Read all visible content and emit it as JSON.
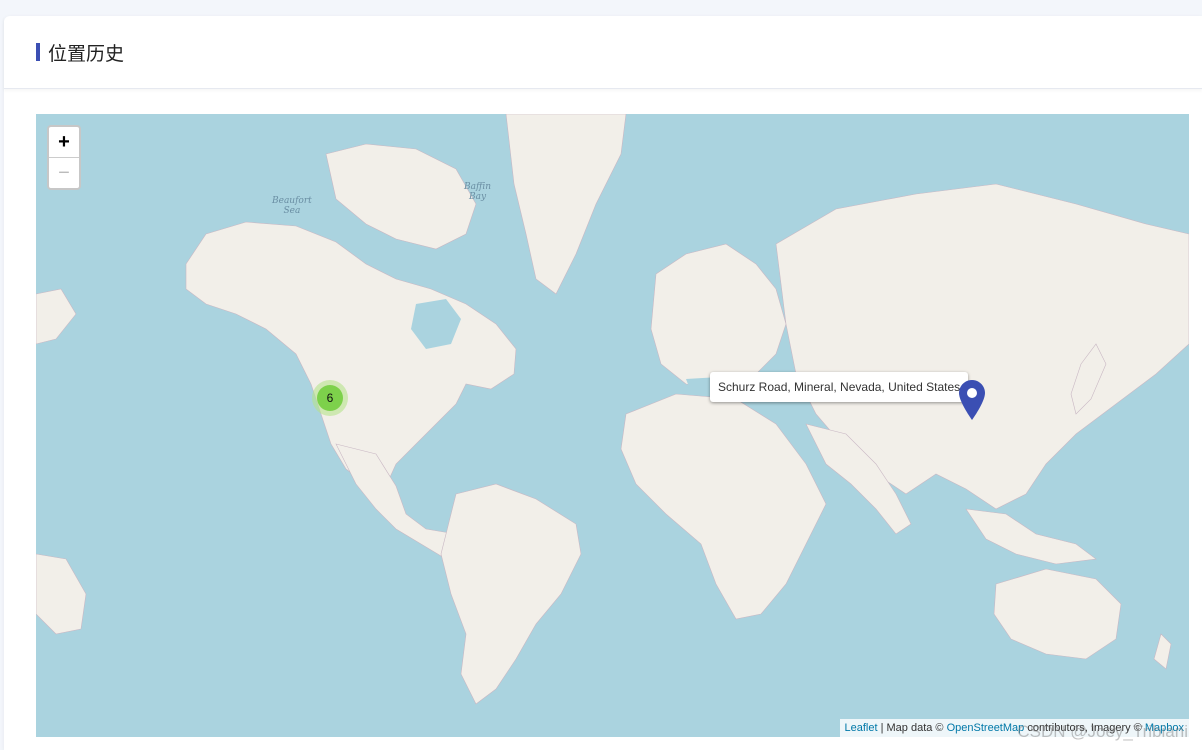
{
  "page": {
    "title": "位置历史"
  },
  "map": {
    "zoom_in": "+",
    "zoom_out": "−",
    "sea_labels": {
      "beaufort": [
        "Beaufort",
        "Sea"
      ],
      "baffin": [
        "Baffin",
        "Bay"
      ]
    },
    "cluster_count": "6",
    "tooltip": "Schurz Road, Mineral, Nevada, United States",
    "attribution": {
      "leaflet": "Leaflet",
      "sep": " | Map data © ",
      "osm": "OpenStreetMap",
      "rest": " contributors, Imagery © ",
      "mapbox": "Mapbox"
    },
    "watermark": "CSDN @Joey_Tribiani",
    "colors": {
      "water": "#aad3df",
      "land": "#f2efe9",
      "pin": "#3b4fb3",
      "cluster_outer": "#b5e28c",
      "cluster_inner": "#6ecc39"
    }
  }
}
